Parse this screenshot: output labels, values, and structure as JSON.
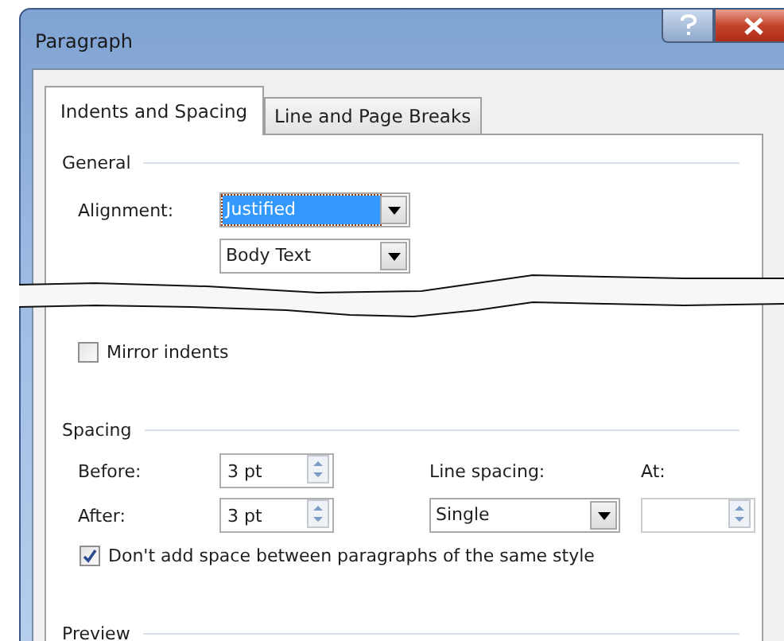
{
  "window": {
    "title": "Paragraph"
  },
  "tabs": [
    {
      "label": "Indents and Spacing",
      "selected": true
    },
    {
      "label": "Line and Page Breaks",
      "selected": false
    }
  ],
  "general": {
    "heading": "General",
    "alignment": {
      "label": "Alignment:",
      "value": "Justified",
      "highlighted": true
    },
    "outline_level": {
      "value": "Body Text",
      "highlighted": false
    },
    "mirror_indents": {
      "label": "Mirror indents",
      "checked": false
    }
  },
  "spacing": {
    "heading": "Spacing",
    "before": {
      "label": "Before:",
      "value": "3 pt"
    },
    "after": {
      "label": "After:",
      "value": "3 pt"
    },
    "line_spacing": {
      "label": "Line spacing:",
      "value": "Single"
    },
    "at": {
      "label": "At:"
    },
    "dont_add_space": {
      "label": "Don't add space between paragraphs of the same style",
      "checked": true
    }
  },
  "preview": {
    "heading": "Preview"
  }
}
